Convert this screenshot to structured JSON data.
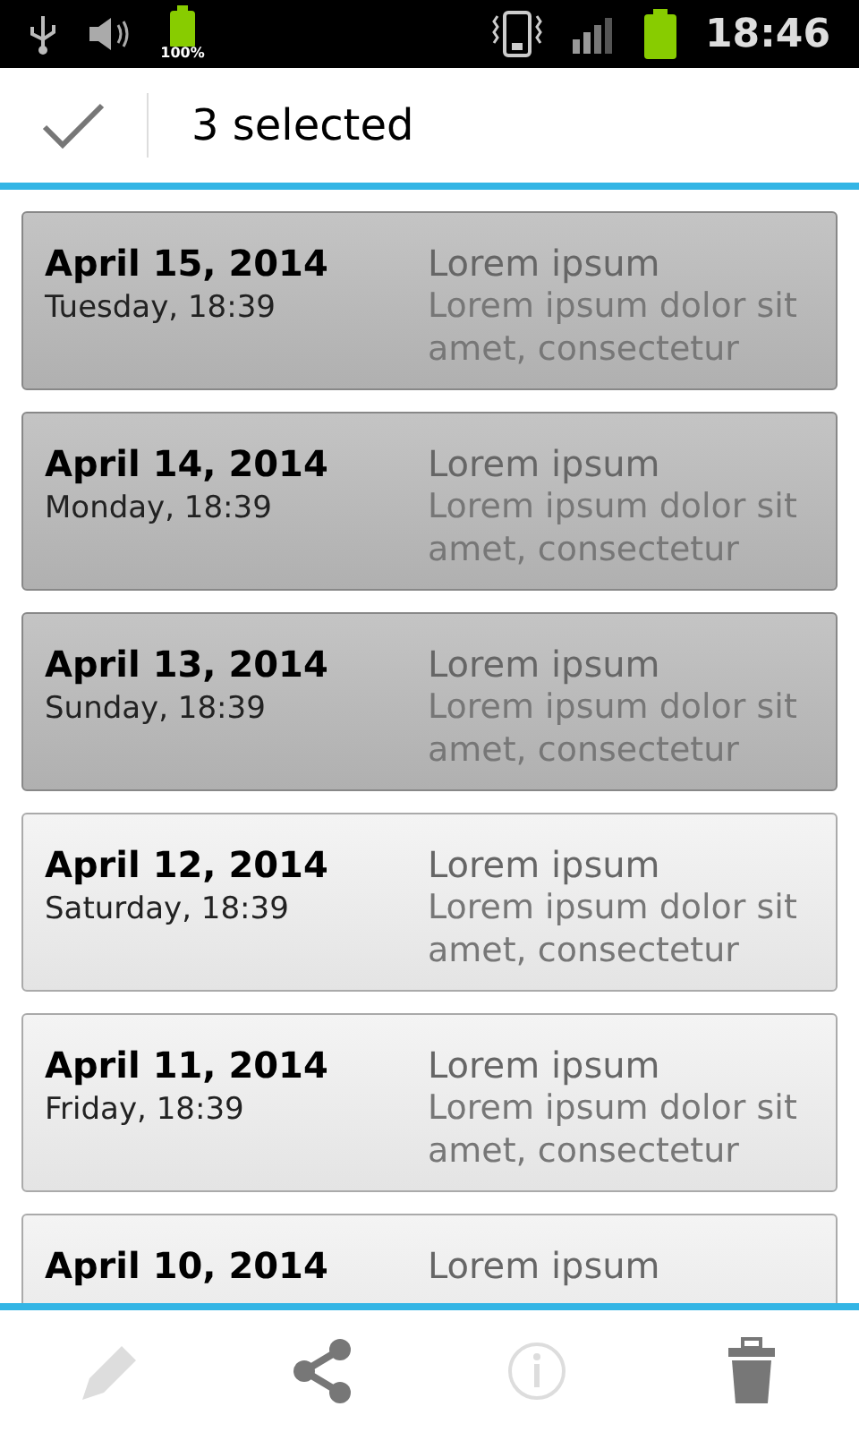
{
  "status_bar": {
    "battery_label": "100%",
    "time": "18:46"
  },
  "action_bar": {
    "title": "3 selected"
  },
  "items": [
    {
      "date": "April 15, 2014",
      "day": "Tuesday, 18:39",
      "title": "Lorem ipsum",
      "body": "Lorem ipsum dolor sit amet, consectetur",
      "selected": true
    },
    {
      "date": "April 14, 2014",
      "day": "Monday, 18:39",
      "title": "Lorem ipsum",
      "body": "Lorem ipsum dolor sit amet, consectetur",
      "selected": true
    },
    {
      "date": "April 13, 2014",
      "day": "Sunday, 18:39",
      "title": "Lorem ipsum",
      "body": "Lorem ipsum dolor sit amet, consectetur",
      "selected": true
    },
    {
      "date": "April 12, 2014",
      "day": "Saturday, 18:39",
      "title": "Lorem ipsum",
      "body": "Lorem ipsum dolor sit amet, consectetur",
      "selected": false
    },
    {
      "date": "April 11, 2014",
      "day": "Friday, 18:39",
      "title": "Lorem ipsum",
      "body": "Lorem ipsum dolor sit amet, consectetur",
      "selected": false
    },
    {
      "date": "April 10, 2014",
      "title": "Lorem ipsum",
      "selected": false
    }
  ],
  "toolbar": [
    {
      "kind": "edit",
      "disabled": true
    },
    {
      "kind": "share",
      "disabled": false
    },
    {
      "kind": "info",
      "disabled": true
    },
    {
      "kind": "delete",
      "disabled": false
    }
  ]
}
